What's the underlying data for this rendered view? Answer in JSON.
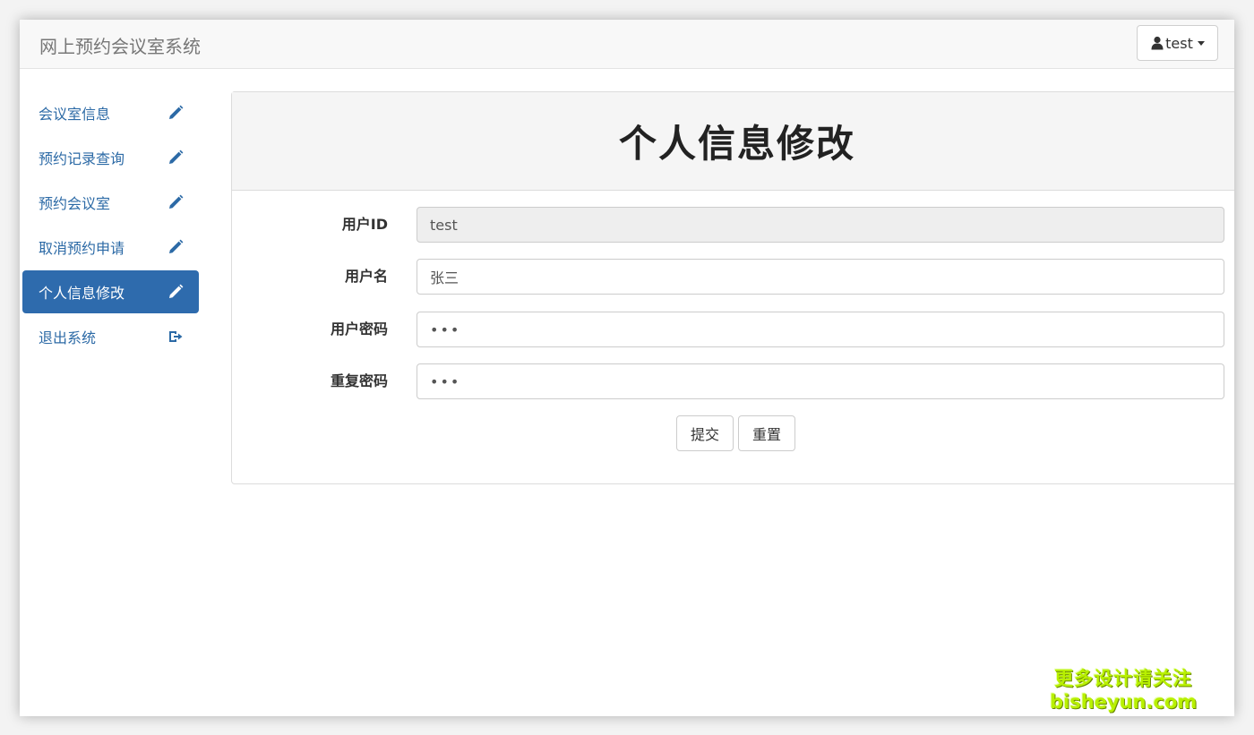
{
  "navbar": {
    "brand": "网上预约会议室系统",
    "user_label": "test",
    "user_icon": "user-icon",
    "caret_icon": "caret-down-icon"
  },
  "sidebar": {
    "items": [
      {
        "label": "会议室信息",
        "icon": "pencil-icon",
        "active": false
      },
      {
        "label": "预约记录查询",
        "icon": "pencil-icon",
        "active": false
      },
      {
        "label": "预约会议室",
        "icon": "pencil-icon",
        "active": false
      },
      {
        "label": "取消预约申请",
        "icon": "pencil-icon",
        "active": false
      },
      {
        "label": "个人信息修改",
        "icon": "pencil-icon",
        "active": true
      },
      {
        "label": "退出系统",
        "icon": "logout-icon",
        "active": false
      }
    ]
  },
  "panel": {
    "title": "个人信息修改",
    "fields": [
      {
        "label": "用户ID",
        "value": "test",
        "readonly": true
      },
      {
        "label": "用户名",
        "value": "张三",
        "readonly": false
      },
      {
        "label": "用户密码",
        "value": "•••",
        "readonly": false
      },
      {
        "label": "重复密码",
        "value": "•••",
        "readonly": false
      }
    ],
    "submit_label": "提交",
    "reset_label": "重置"
  },
  "watermark": {
    "line1": "更多设计请关注",
    "line2": "bisheyun.com"
  },
  "colors": {
    "accent": "#2e6bad",
    "link": "#2c6aa6",
    "navbar_bg": "#f8f8f8",
    "watermark": "#b8f000"
  }
}
